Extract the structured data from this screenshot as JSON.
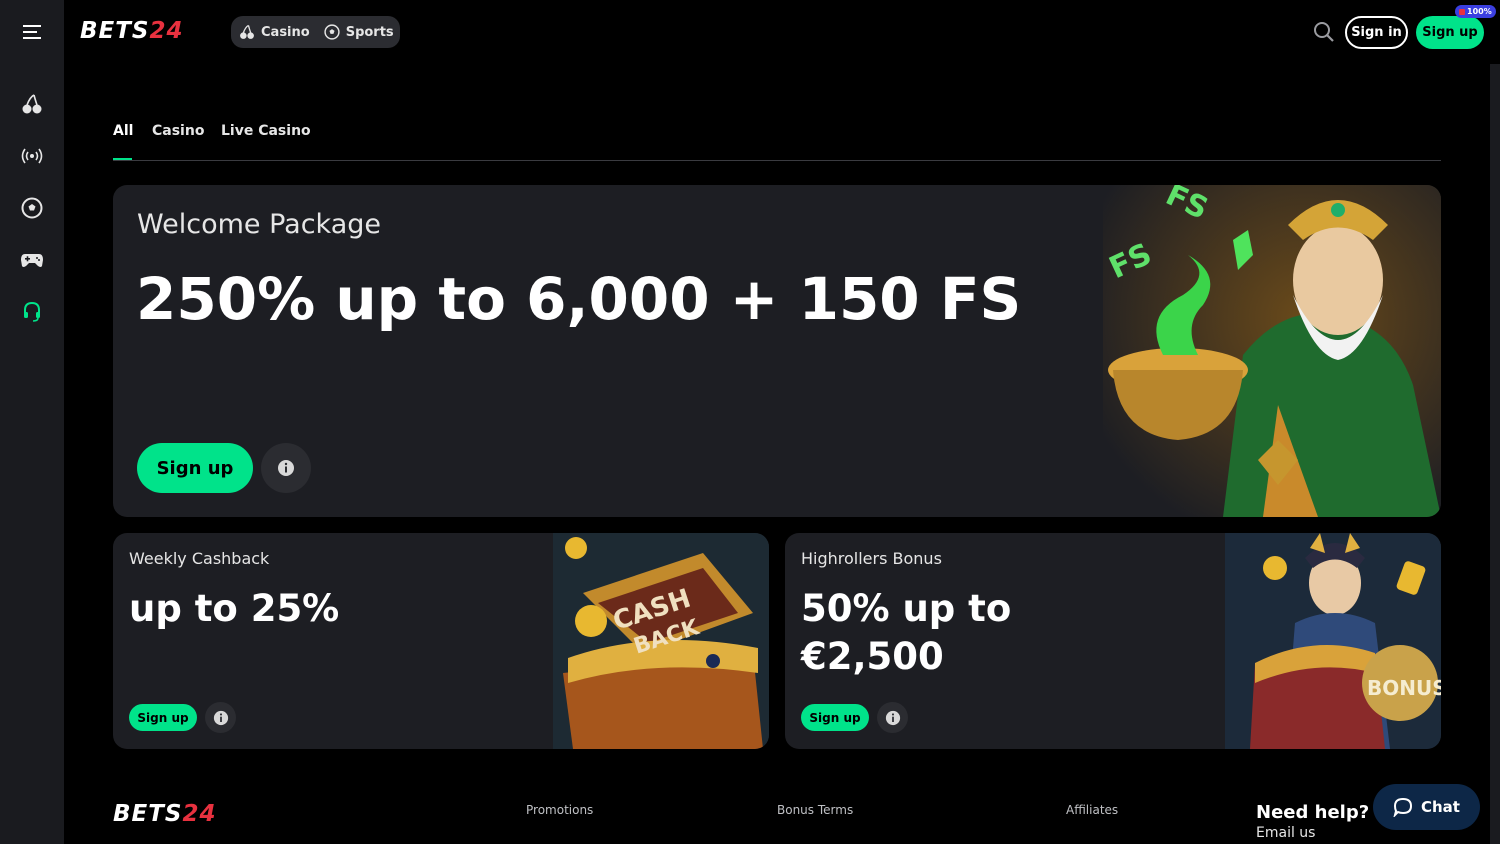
{
  "brand": {
    "logo_main": "BETS",
    "logo_num": "24"
  },
  "top_nav": {
    "pills": [
      {
        "label": "Casino",
        "icon": "cherry-icon"
      },
      {
        "label": "Sports",
        "icon": "soccer-ball-icon"
      }
    ],
    "search_icon": "search-icon",
    "sign_in": "Sign in",
    "sign_up": "Sign up",
    "badge": "100%"
  },
  "sidebar": {
    "items": [
      {
        "icon": "menu-icon"
      },
      {
        "icon": "cherry-icon"
      },
      {
        "icon": "live-broadcast-icon"
      },
      {
        "icon": "soccer-ball-icon"
      },
      {
        "icon": "gamepad-icon"
      },
      {
        "icon": "headset-support-icon"
      }
    ]
  },
  "tabs": [
    {
      "label": "All",
      "active": true
    },
    {
      "label": "Casino",
      "active": false
    },
    {
      "label": "Live Casino",
      "active": false
    }
  ],
  "promos": {
    "welcome": {
      "title": "Welcome Package",
      "headline": "250% up to 6,000 + 150 FS",
      "cta": "Sign up",
      "art_text": "FS"
    },
    "cashback": {
      "title": "Weekly Cashback",
      "headline": "up to 25%",
      "cta": "Sign up",
      "art_text_1": "CASH",
      "art_text_2": "BACK"
    },
    "highrollers": {
      "title": "Highrollers Bonus",
      "headline_1": "50% up to",
      "headline_2": "€2,500",
      "cta": "Sign up",
      "art_text": "BONUS"
    }
  },
  "footer": {
    "links": [
      "Promotions",
      "Bonus Terms",
      "Affiliates"
    ],
    "need_help": "Need help?",
    "email_us": "Email us"
  },
  "chat": {
    "label": "Chat"
  },
  "colors": {
    "accent": "#00e38a",
    "brand_red": "#e8313f",
    "card_bg": "#1d1e23",
    "sidebar_bg": "#1a1b1f"
  }
}
